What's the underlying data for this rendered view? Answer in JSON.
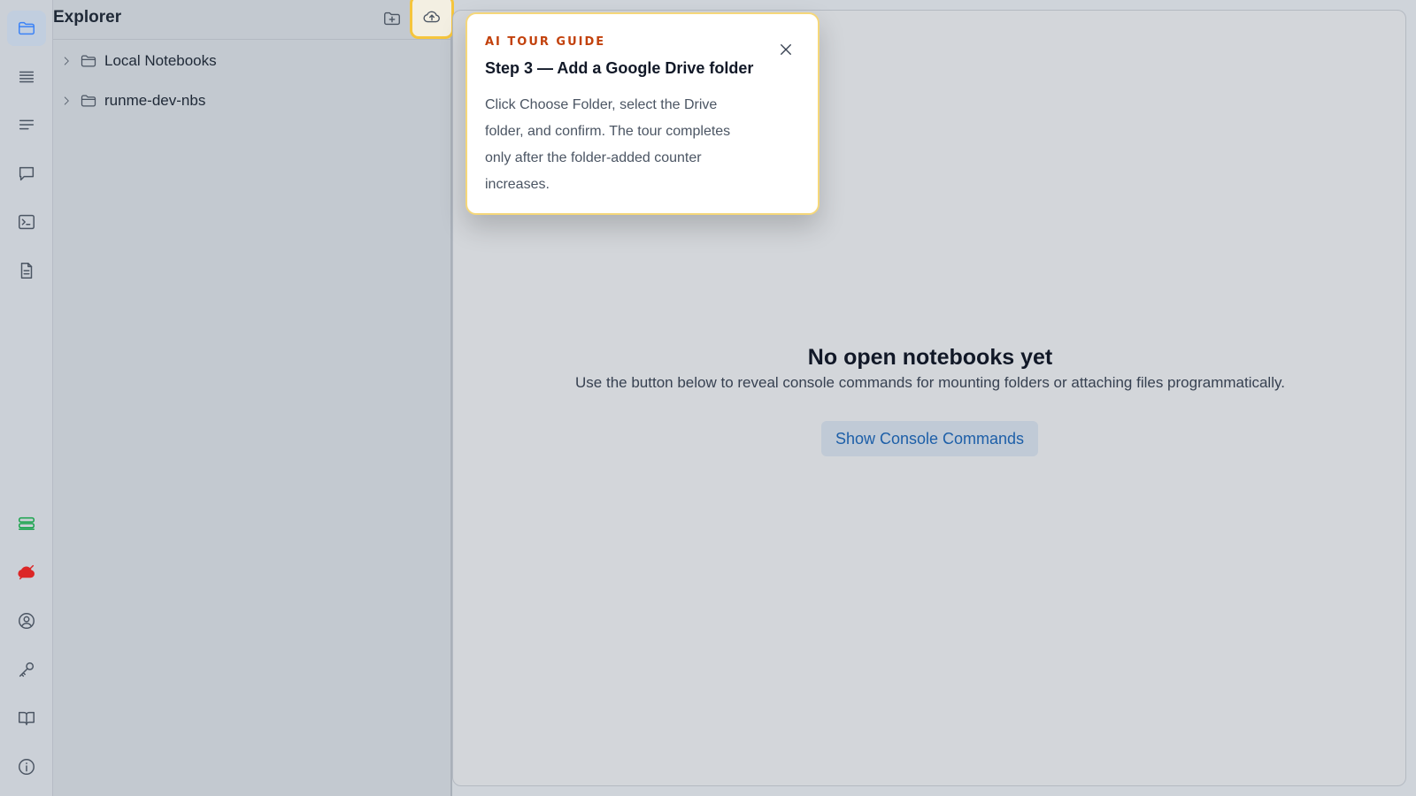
{
  "explorer": {
    "title": "Explorer",
    "actions": [
      {
        "icon": "folder-plus-icon",
        "label": ""
      },
      {
        "icon": "cloud-upload-icon",
        "label": ""
      }
    ],
    "tree": [
      {
        "label": "Local Notebooks",
        "icon": "folder-icon",
        "expanded": false
      },
      {
        "label": "runme-dev-nbs",
        "icon": "folder-icon",
        "expanded": false
      }
    ]
  },
  "rail": {
    "top": [
      "folder-icon",
      "list-icon",
      "lines-icon",
      "chat-icon",
      "terminal-icon",
      "document-icon"
    ],
    "bottom": [
      "storage-icon",
      "cloud-off-icon",
      "user-circle-icon",
      "key-icon",
      "book-icon",
      "info-icon"
    ],
    "colors": {
      "active": "#3b82f6",
      "storage": "#16a34a",
      "cloud_off": "#dc2626"
    }
  },
  "main": {
    "empty_title": "No open notebooks yet",
    "empty_subtitle": "Use the button below to reveal console commands for mounting folders or attaching files programmatically.",
    "console_button": "Show Console Commands"
  },
  "tour": {
    "eyebrow": "AI TOUR GUIDE",
    "title": "Step 3 — Add a Google Drive folder",
    "body": "Click Choose Folder, select the Drive folder, and confirm. The tour completes only after the folder-added counter increases.",
    "accent": "#f5c53d"
  }
}
